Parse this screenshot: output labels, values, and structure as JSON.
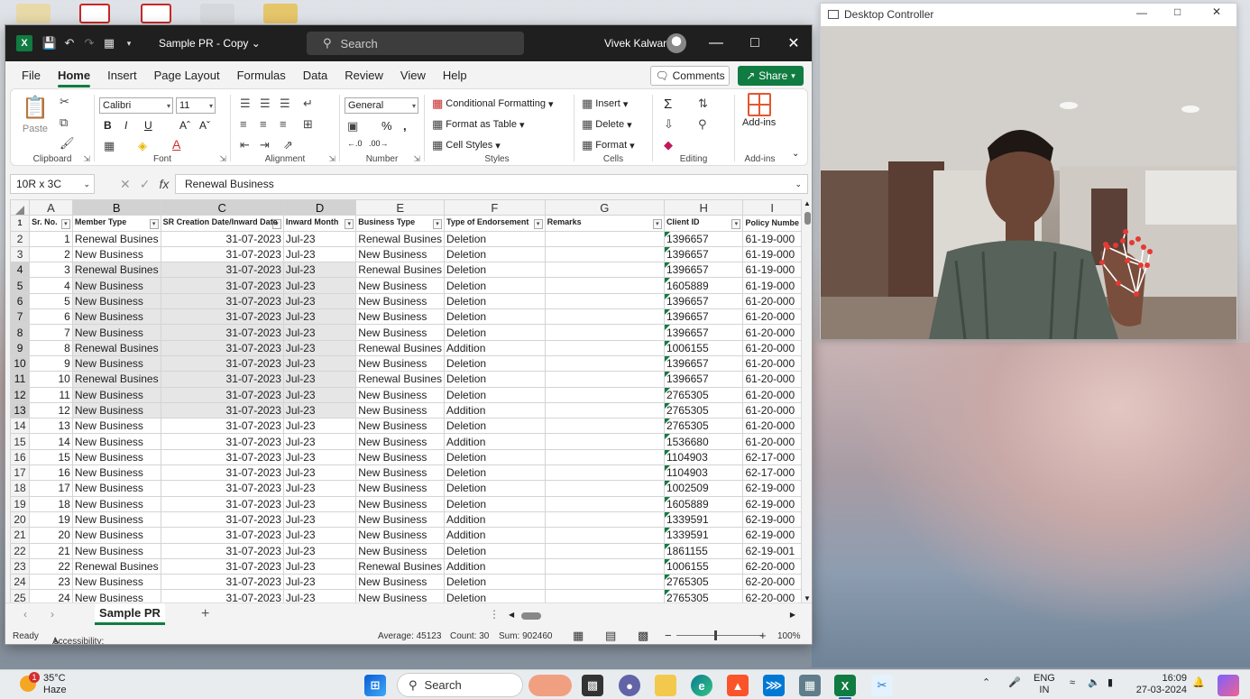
{
  "excel": {
    "doc_title": "Sample PR - Copy",
    "search_placeholder": "Search",
    "user_name": "Vivek Kalwar",
    "menu": [
      "File",
      "Home",
      "Insert",
      "Page Layout",
      "Formulas",
      "Data",
      "Review",
      "View",
      "Help"
    ],
    "comments_label": "Comments",
    "share_label": "Share",
    "ribbon": {
      "clipboard": {
        "paste": "Paste",
        "label": "Clipboard"
      },
      "font": {
        "name": "Calibri",
        "size": "11",
        "label": "Font"
      },
      "alignment": {
        "label": "Alignment"
      },
      "number": {
        "format": "General",
        "label": "Number"
      },
      "styles": {
        "conditional": "Conditional Formatting",
        "format_table": "Format as Table",
        "cell_styles": "Cell Styles",
        "label": "Styles"
      },
      "cells": {
        "insert": "Insert",
        "delete": "Delete",
        "format": "Format",
        "label": "Cells"
      },
      "editing": {
        "label": "Editing"
      },
      "addins": {
        "button": "Add-ins",
        "label": "Add-ins"
      }
    },
    "name_box": "10R x 3C",
    "formula": "Renewal Business",
    "columns": [
      "A",
      "B",
      "C",
      "D",
      "E",
      "F",
      "G",
      "H",
      "I"
    ],
    "headers": [
      "Sr. No.",
      "Member Type",
      "SR Creation Date/Inward Date",
      "Inward Month",
      "Business Type",
      "Type of Endorsement",
      "Remarks",
      "Client ID",
      "Policy Numbe"
    ],
    "rows": [
      [
        "1",
        "Renewal Busines",
        "31-07-2023",
        "Jul-23",
        "Renewal Busines",
        "Deletion",
        "",
        "1396657",
        "61-19-000"
      ],
      [
        "2",
        "New Business",
        "31-07-2023",
        "Jul-23",
        "New Business",
        "Deletion",
        "",
        "1396657",
        "61-19-000"
      ],
      [
        "3",
        "Renewal Busines",
        "31-07-2023",
        "Jul-23",
        "Renewal Busines",
        "Deletion",
        "",
        "1396657",
        "61-19-000"
      ],
      [
        "4",
        "New Business",
        "31-07-2023",
        "Jul-23",
        "New Business",
        "Deletion",
        "",
        "1605889",
        "61-19-000"
      ],
      [
        "5",
        "New Business",
        "31-07-2023",
        "Jul-23",
        "New Business",
        "Deletion",
        "",
        "1396657",
        "61-20-000"
      ],
      [
        "6",
        "New Business",
        "31-07-2023",
        "Jul-23",
        "New Business",
        "Deletion",
        "",
        "1396657",
        "61-20-000"
      ],
      [
        "7",
        "New Business",
        "31-07-2023",
        "Jul-23",
        "New Business",
        "Deletion",
        "",
        "1396657",
        "61-20-000"
      ],
      [
        "8",
        "Renewal Busines",
        "31-07-2023",
        "Jul-23",
        "Renewal Busines",
        "Addition",
        "",
        "1006155",
        "61-20-000"
      ],
      [
        "9",
        "New Business",
        "31-07-2023",
        "Jul-23",
        "New Business",
        "Deletion",
        "",
        "1396657",
        "61-20-000"
      ],
      [
        "10",
        "Renewal Busines",
        "31-07-2023",
        "Jul-23",
        "Renewal Busines",
        "Deletion",
        "",
        "1396657",
        "61-20-000"
      ],
      [
        "11",
        "New Business",
        "31-07-2023",
        "Jul-23",
        "New Business",
        "Deletion",
        "",
        "2765305",
        "61-20-000"
      ],
      [
        "12",
        "New Business",
        "31-07-2023",
        "Jul-23",
        "New Business",
        "Addition",
        "",
        "2765305",
        "61-20-000"
      ],
      [
        "13",
        "New Business",
        "31-07-2023",
        "Jul-23",
        "New Business",
        "Deletion",
        "",
        "2765305",
        "61-20-000"
      ],
      [
        "14",
        "New Business",
        "31-07-2023",
        "Jul-23",
        "New Business",
        "Addition",
        "",
        "1536680",
        "61-20-000"
      ],
      [
        "15",
        "New Business",
        "31-07-2023",
        "Jul-23",
        "New Business",
        "Deletion",
        "",
        "1104903",
        "62-17-000"
      ],
      [
        "16",
        "New Business",
        "31-07-2023",
        "Jul-23",
        "New Business",
        "Deletion",
        "",
        "1104903",
        "62-17-000"
      ],
      [
        "17",
        "New Business",
        "31-07-2023",
        "Jul-23",
        "New Business",
        "Deletion",
        "",
        "1002509",
        "62-19-000"
      ],
      [
        "18",
        "New Business",
        "31-07-2023",
        "Jul-23",
        "New Business",
        "Deletion",
        "",
        "1605889",
        "62-19-000"
      ],
      [
        "19",
        "New Business",
        "31-07-2023",
        "Jul-23",
        "New Business",
        "Addition",
        "",
        "1339591",
        "62-19-000"
      ],
      [
        "20",
        "New Business",
        "31-07-2023",
        "Jul-23",
        "New Business",
        "Addition",
        "",
        "1339591",
        "62-19-000"
      ],
      [
        "21",
        "New Business",
        "31-07-2023",
        "Jul-23",
        "New Business",
        "Deletion",
        "",
        "1861155",
        "62-19-001"
      ],
      [
        "22",
        "Renewal Busines",
        "31-07-2023",
        "Jul-23",
        "Renewal Busines",
        "Addition",
        "",
        "1006155",
        "62-20-000"
      ],
      [
        "23",
        "New Business",
        "31-07-2023",
        "Jul-23",
        "New Business",
        "Deletion",
        "",
        "2765305",
        "62-20-000"
      ],
      [
        "24",
        "New Business",
        "31-07-2023",
        "Jul-23",
        "New Business",
        "Deletion",
        "",
        "2765305",
        "62-20-000"
      ]
    ],
    "sheet_tab": "Sample PR",
    "status": {
      "ready": "Ready",
      "accessibility": "Accessibility: Good to go",
      "average": "Average: 45123",
      "count": "Count: 30",
      "sum": "Sum: 902460",
      "zoom": "100%"
    }
  },
  "controller": {
    "title": "Desktop Controller"
  },
  "taskbar": {
    "weather_temp": "35°C",
    "weather_desc": "Haze",
    "weather_badge": "1",
    "search_label": "Search",
    "lang": "ENG",
    "region": "IN",
    "time": "16:09",
    "date": "27-03-2024"
  },
  "colors": {
    "excel_green": "#107c41",
    "titlebar": "#1f1f1f"
  }
}
